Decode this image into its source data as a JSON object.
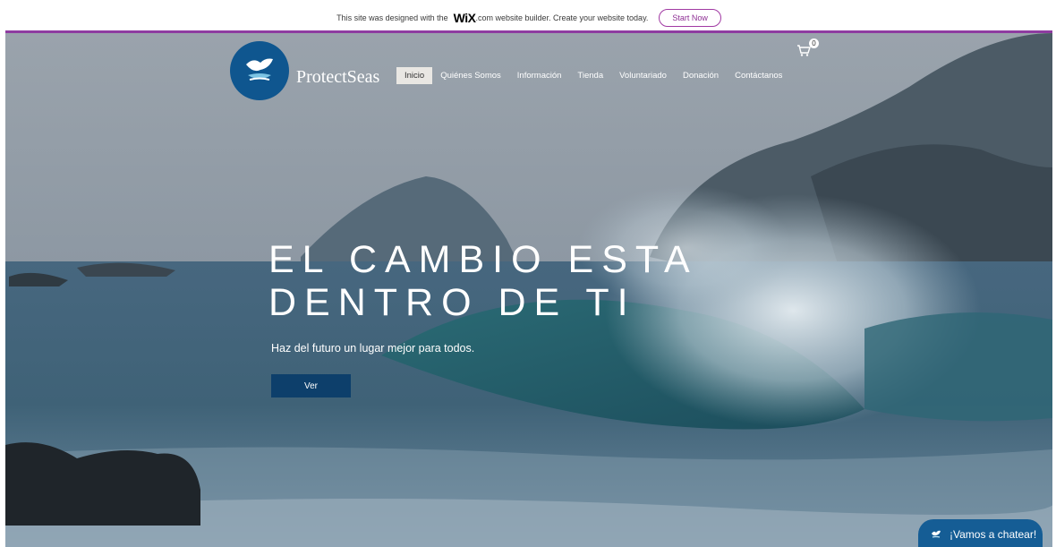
{
  "wix_banner": {
    "text_before": "This site was designed with the",
    "logo": "WiX",
    "text_after": ".com website builder. Create your website today.",
    "cta": "Start Now"
  },
  "header": {
    "brand": "ProtectSeas",
    "nav": [
      {
        "label": "Inicio",
        "active": true
      },
      {
        "label": "Quiénes Somos"
      },
      {
        "label": "Información"
      },
      {
        "label": "Tienda"
      },
      {
        "label": "Voluntariado"
      },
      {
        "label": "Donación"
      },
      {
        "label": "Contáctanos"
      }
    ],
    "cart_count": "0"
  },
  "hero": {
    "headline_line1": "EL CAMBIO ESTA",
    "headline_line2": "DENTRO DE TI",
    "subtitle": "Haz del futuro un lugar mejor para todos.",
    "button": "Ver"
  },
  "chat": {
    "label": "¡Vamos a chatear!"
  },
  "colors": {
    "wix_accent": "#8e3ca0",
    "logo_blue": "#0f568f",
    "button_navy": "#0d3f6b",
    "chat_blue": "#155d95"
  }
}
